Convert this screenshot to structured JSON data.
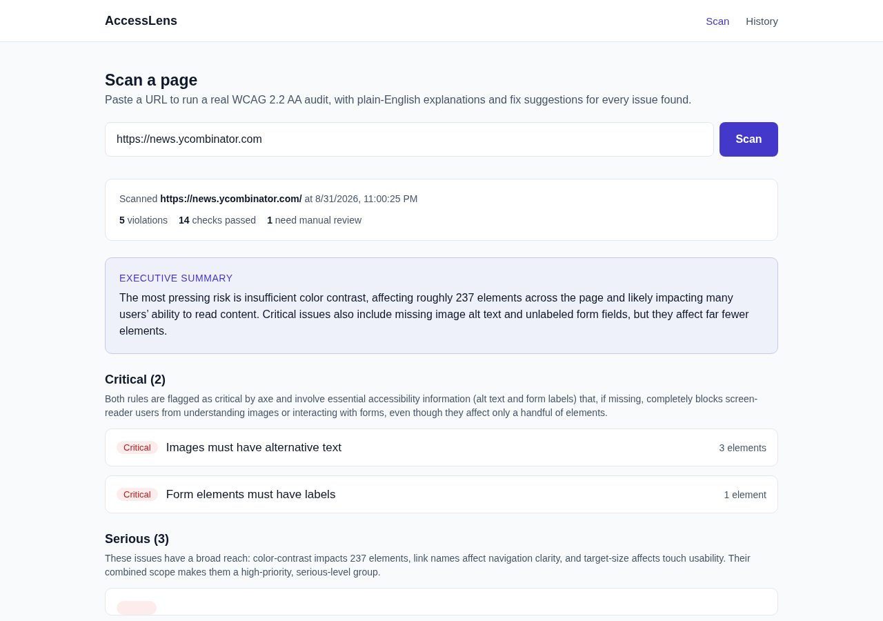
{
  "header": {
    "brand": "AccessLens",
    "nav": [
      {
        "label": "Scan",
        "selected": true
      },
      {
        "label": "History",
        "selected": false
      }
    ]
  },
  "intro": {
    "title": "Scan a page",
    "description": "Paste a URL to run a real WCAG 2.2 AA audit, with plain-English explanations and fix suggestions for every issue found."
  },
  "scan_form": {
    "url_value": "https://news.ycombinator.com",
    "button": "Scan"
  },
  "scan_result": {
    "scanned_text": "Scanned **https://news.ycombinator.com/** at 8/31/2026, 11:00:25 PM",
    "stats": [
      "**5** violations",
      "**14** checks passed",
      "**1** need manual review"
    ]
  },
  "summary": {
    "heading": "EXECUTIVE SUMMARY",
    "text": "The most pressing risk is insufficient color contrast, affecting roughly 237 elements across the page and likely impacting many users’ ability to read content. Critical issues also include missing image alt text and unlabeled form fields, but they affect far fewer elements."
  },
  "groups": [
    {
      "title": "Critical (2)",
      "description": "Both rules are flagged as critical by axe and involve essential accessibility information (alt text and form labels) that, if missing, completely blocks screen-reader users from understanding images or interacting with forms, even though they affect only a handful of elements.",
      "issues": [
        {
          "kind": "full",
          "severity": "Critical",
          "title": "Images must have alternative text",
          "count": "3 elements"
        },
        {
          "kind": "full",
          "severity": "Critical",
          "title": "Form elements must have labels",
          "count": "1 element"
        }
      ]
    },
    {
      "title": "Serious (3)",
      "description": "These issues have a broad reach: color-contrast impacts 237 elements, link names affect navigation clarity, and target-size affects touch usability. Their combined scope makes them a high-priority, serious-level group.",
      "issues": [
        {
          "kind": "partial"
        }
      ]
    }
  ]
}
